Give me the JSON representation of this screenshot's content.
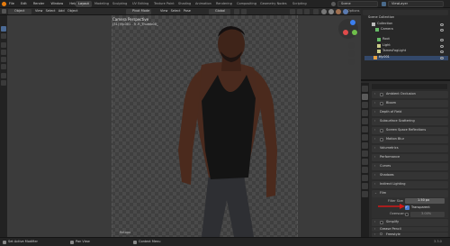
{
  "topbar": {
    "menu": [
      "File",
      "Edit",
      "Render",
      "Window",
      "Help"
    ],
    "workspaces": [
      "Layout",
      "Modeling",
      "Sculpting",
      "UV Editing",
      "Texture Paint",
      "Shading",
      "Animation",
      "Rendering",
      "Compositing",
      "Geometry Nodes",
      "Scripting"
    ],
    "active_workspace": "Layout",
    "scene_label": "Scene",
    "view_layer_label": "ViewLayer"
  },
  "toolbar": {
    "mode": "Object",
    "items": [
      "View",
      "Select",
      "Add",
      "Object"
    ],
    "orientation": "Global",
    "view_items": [
      "View",
      "Select",
      "Pose"
    ],
    "pivot": "Pivot Mode",
    "options": "Options"
  },
  "viewport": {
    "camera_title": "Camera Perspective",
    "camera_subtitle": "(31) tfy.001 - 5 .R_Thumb00_",
    "footer_label": "Retopo"
  },
  "outliner": {
    "rows": [
      {
        "label": "Scene Collection"
      },
      {
        "label": "Collection"
      },
      {
        "label": "Camera"
      },
      {
        "label": "Root"
      },
      {
        "label": "Light"
      },
      {
        "label": "TamesFogLight"
      },
      {
        "label": "tfy.001"
      }
    ]
  },
  "properties": {
    "panels": [
      {
        "label": "Ambient Occlusion",
        "checkbox": true
      },
      {
        "label": "Bloom",
        "checkbox": true
      },
      {
        "label": "Depth of Field",
        "checkbox": false
      },
      {
        "label": "Subsurface Scattering",
        "checkbox": false
      },
      {
        "label": "Screen Space Reflections",
        "checkbox": true
      },
      {
        "label": "Motion Blur",
        "checkbox": true
      },
      {
        "label": "Volumetrics",
        "checkbox": false
      },
      {
        "label": "Performance",
        "checkbox": false
      },
      {
        "label": "Curves",
        "checkbox": false
      },
      {
        "label": "Shadows",
        "checkbox": false
      },
      {
        "label": "Indirect Lighting",
        "checkbox": false
      },
      {
        "label": "Film",
        "checkbox": false
      }
    ],
    "film": {
      "filter_size_label": "Filter Size",
      "filter_size_value": "1.50 px",
      "transparent_label": "Transparent",
      "overscan_label": "Overscan",
      "overscan_value": "3.00%"
    },
    "after_panels": [
      {
        "label": "Simplify",
        "checkbox": true
      },
      {
        "label": "Grease Pencil",
        "checkbox": false
      },
      {
        "label": "Freestyle",
        "checkbox": true
      },
      {
        "label": "Color Management",
        "checkbox": false
      }
    ]
  },
  "statusbar": {
    "items": [
      "Set Active Modifier",
      "Pan View",
      "Context Menu"
    ],
    "version": "3.3.0"
  }
}
